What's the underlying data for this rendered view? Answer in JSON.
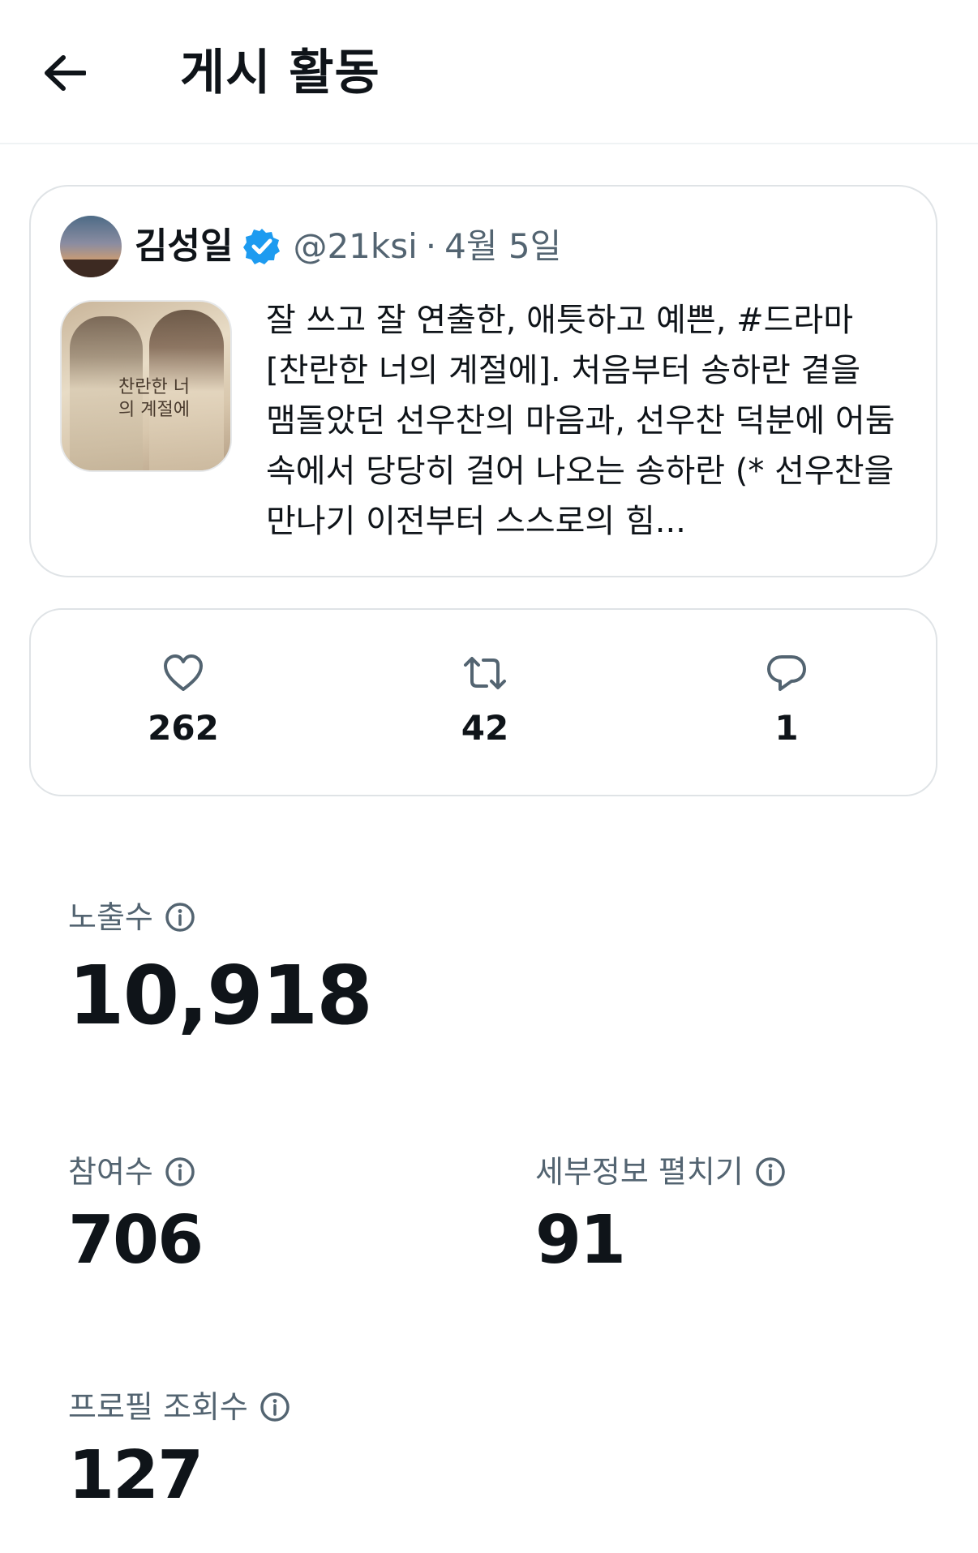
{
  "header": {
    "title": "게시 활동",
    "back_icon": "arrow-left-icon"
  },
  "post": {
    "author_name": "김성일",
    "verified_icon": "verified-badge-icon",
    "verified_color": "#1d9bf0",
    "handle": "@21ksi",
    "separator": "·",
    "date": "4월 5일",
    "thumbnail_text": "찬란한 너의 계절에",
    "text": "잘 쓰고 잘 연출한, 애틋하고 예쁜, #드라마 [찬란한 너의 계절에]. 처음부터 송하란 곁을 맴돌았던 선우찬의 마음과, 선우찬 덕분에 어둠 속에서 당당히 걸어 나오는 송하란 (* 선우찬을 만나기 이전부터 스스로의 힘..."
  },
  "engagement": {
    "likes": {
      "icon": "heart-icon",
      "count": "262"
    },
    "reposts": {
      "icon": "repost-icon",
      "count": "42"
    },
    "replies": {
      "icon": "reply-icon",
      "count": "1"
    }
  },
  "metrics": {
    "impressions": {
      "label": "노출수",
      "value": "10,918",
      "info_icon": "info-icon"
    },
    "engagements": {
      "label": "참여수",
      "value": "706",
      "info_icon": "info-icon"
    },
    "detail_expands": {
      "label": "세부정보 펼치기",
      "value": "91",
      "info_icon": "info-icon"
    },
    "profile_visits": {
      "label": "프로필 조회수",
      "value": "127",
      "info_icon": "info-icon"
    }
  },
  "colors": {
    "text_primary": "#0f1419",
    "text_secondary": "#536471",
    "border": "#dfe3e6"
  }
}
